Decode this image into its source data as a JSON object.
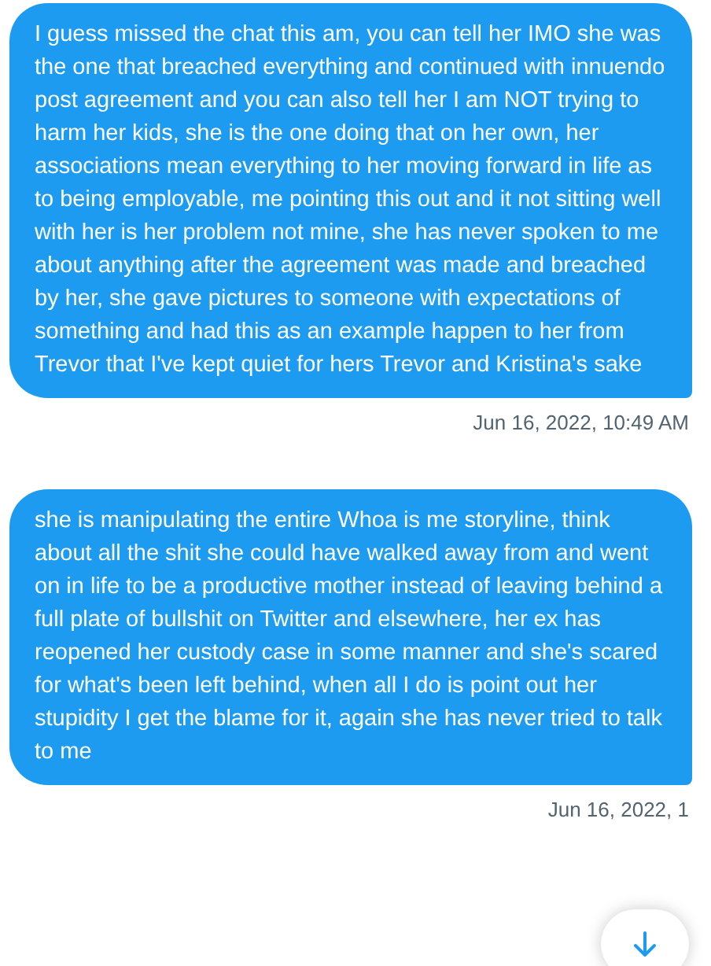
{
  "messages": [
    {
      "text": "I guess missed the chat this am, you can tell her IMO she was the one that breached everything and continued with innuendo post agreement and you can also tell her I am NOT trying to harm her kids, she is the one doing that on her own, her associations mean everything to her moving forward in life as to being employable, me pointing this out and it not sitting well with her is her problem not mine, she has never spoken to me about anything after the agreement was made and breached by her, she gave pictures to someone with expectations of something and had this as an example happen to her from Trevor that I've kept quiet for hers Trevor and Kristina's sake",
      "time": "Jun 16, 2022, 10:49 AM"
    },
    {
      "text": "she is manipulating the entire Whoa is me storyline, think about all the shit she could have walked away from and went on in life to be a productive mother instead of leaving behind a full plate of bullshit on Twitter and elsewhere, her ex has reopened her custody case in some manner and she's scared for what's been left behind, when all I do is point out her stupidity I get the blame for it, again she has never tried to talk to me",
      "time": "Jun 16, 2022, 1"
    }
  ]
}
